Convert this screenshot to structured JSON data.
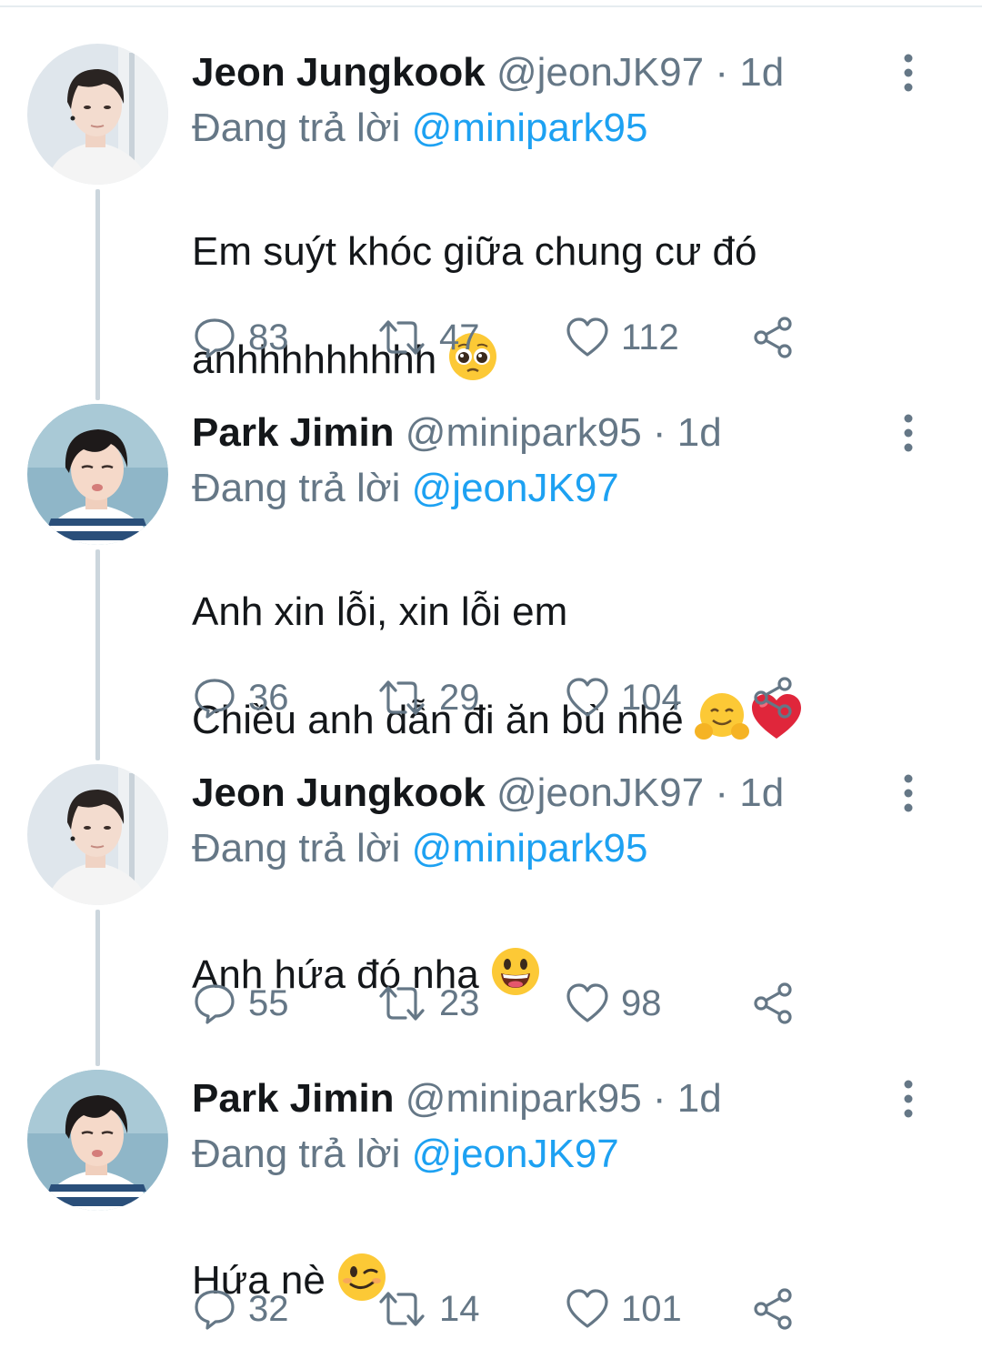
{
  "tweets": [
    {
      "display_name": "Jeon Jungkook",
      "handle": "@jeonJK97",
      "dot": "·",
      "time": "1d",
      "replying_prefix": "Đang trả lời",
      "replying_to": "@minipark95",
      "text_lines": [
        "Em suýt khóc giữa chung cư đó",
        "anhhhhhhhhh"
      ],
      "emojis": [
        "pleading-face-emoji"
      ],
      "replies": "83",
      "retweets": "47",
      "likes": "112",
      "avatar": "jungkook-avatar"
    },
    {
      "display_name": "Park Jimin",
      "handle": "@minipark95",
      "dot": "·",
      "time": "1d",
      "replying_prefix": "Đang trả lời",
      "replying_to": "@jeonJK97",
      "text_lines": [
        "Anh xin lỗi, xin lỗi em",
        "Chiều anh dẫn đi ăn bù nhé"
      ],
      "emojis": [
        "hugging-face-emoji",
        "red-heart-emoji"
      ],
      "replies": "36",
      "retweets": "29",
      "likes": "104",
      "avatar": "jimin-avatar"
    },
    {
      "display_name": "Jeon Jungkook",
      "handle": "@jeonJK97",
      "dot": "·",
      "time": "1d",
      "replying_prefix": "Đang trả lời",
      "replying_to": "@minipark95",
      "text_lines": [
        "Anh hứa đó nha"
      ],
      "emojis": [
        "grinning-face-emoji"
      ],
      "replies": "55",
      "retweets": "23",
      "likes": "98",
      "avatar": "jungkook-avatar"
    },
    {
      "display_name": "Park Jimin",
      "handle": "@minipark95",
      "dot": "·",
      "time": "1d",
      "replying_prefix": "Đang trả lời",
      "replying_to": "@jeonJK97",
      "text_lines": [
        "Hứa nè"
      ],
      "emojis": [
        "winking-face-emoji"
      ],
      "replies": "32",
      "retweets": "14",
      "likes": "101",
      "avatar": "jimin-avatar"
    }
  ],
  "icons": {
    "reply": "reply-icon",
    "retweet": "retweet-icon",
    "like": "heart-icon",
    "share": "share-icon",
    "more": "more-vertical-icon"
  },
  "colors": {
    "text": "#14171a",
    "secondary": "#657786",
    "mention": "#1da1f2",
    "thread_line": "#ccd6dd"
  }
}
